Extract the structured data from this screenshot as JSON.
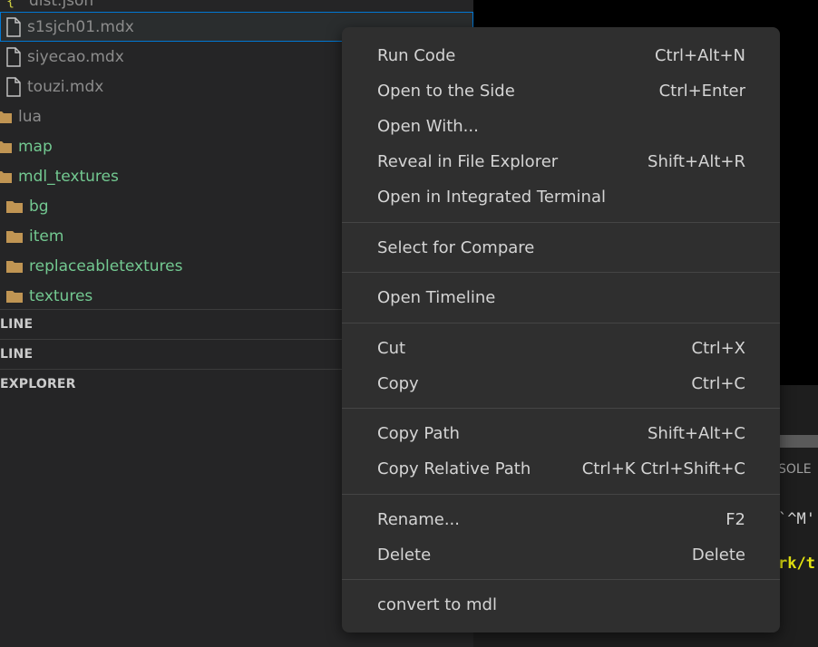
{
  "explorer": {
    "files": [
      {
        "label": "dist.json",
        "kind": "json"
      },
      {
        "label": "s1sjch01.mdx",
        "kind": "file"
      },
      {
        "label": "siyecao.mdx",
        "kind": "file"
      },
      {
        "label": "touzi.mdx",
        "kind": "file"
      }
    ],
    "folders": [
      {
        "label": "lua"
      },
      {
        "label": "map"
      },
      {
        "label": "mdl_textures"
      },
      {
        "label": "bg"
      },
      {
        "label": "item"
      },
      {
        "label": "replaceabletextures"
      },
      {
        "label": "textures"
      }
    ],
    "sections": [
      "LINE",
      "LINE",
      "EXPLORER"
    ]
  },
  "panel": {
    "tab_label": "SOLE",
    "lines": [
      "`^M'",
      "rk/t"
    ]
  },
  "context_menu": {
    "items": [
      {
        "label": "Run Code",
        "shortcut": "Ctrl+Alt+N"
      },
      {
        "label": "Open to the Side",
        "shortcut": "Ctrl+Enter"
      },
      {
        "label": "Open With...",
        "shortcut": ""
      },
      {
        "label": "Reveal in File Explorer",
        "shortcut": "Shift+Alt+R"
      },
      {
        "label": "Open in Integrated Terminal",
        "shortcut": ""
      },
      {
        "label": "Select for Compare",
        "shortcut": ""
      },
      {
        "label": "Open Timeline",
        "shortcut": ""
      },
      {
        "label": "Cut",
        "shortcut": "Ctrl+X"
      },
      {
        "label": "Copy",
        "shortcut": "Ctrl+C"
      },
      {
        "label": "Copy Path",
        "shortcut": "Shift+Alt+C"
      },
      {
        "label": "Copy Relative Path",
        "shortcut": "Ctrl+K Ctrl+Shift+C"
      },
      {
        "label": "Rename...",
        "shortcut": "F2"
      },
      {
        "label": "Delete",
        "shortcut": "Delete"
      },
      {
        "label": "convert to mdl",
        "shortcut": ""
      }
    ]
  },
  "colors": {
    "sidebar_bg": "#252526",
    "menu_bg": "#2f2f2f",
    "folder_icon": "#c09553",
    "json_icon": "#cbcb41",
    "git_added_text": "#73c991",
    "terminal_yellow": "#e5e510",
    "selection_border": "#0078d4"
  }
}
